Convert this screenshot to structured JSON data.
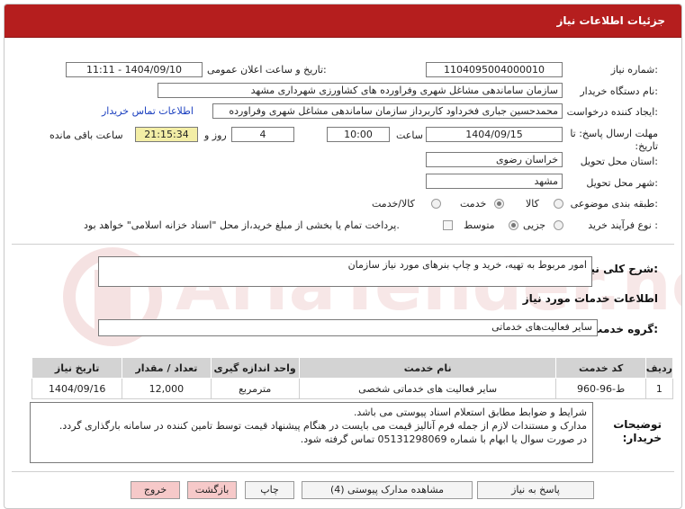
{
  "header": {
    "title": "جزئیات اطلاعات نیاز"
  },
  "form": {
    "need_number_label": "شماره نیاز:",
    "need_number": "1104095004000010",
    "announce_label": "تاریخ و ساعت اعلان عمومی:",
    "announce_value": "1404/09/10 - 11:11",
    "buyer_org_label": "نام دستگاه خریدار:",
    "buyer_org": "سازمان ساماندهی مشاغل شهری وفراورده های کشاورزی شهرداری مشهد",
    "creator_label": "ایجاد کننده درخواست:",
    "creator": "محمدحسین جباری فخرداود کاربرداز سازمان ساماندهی مشاغل شهری وفراورده",
    "contact_link": "اطلاعات تماس خریدار",
    "deadline_label": "مهلت ارسال پاسخ: تا تاریخ:",
    "deadline_date": "1404/09/15",
    "time_label": "ساعت",
    "deadline_time": "10:00",
    "days_value": "4",
    "days_label": "روز و",
    "remaining_time": "21:15:34",
    "remaining_label": "ساعت باقی مانده",
    "province_label": "استان محل تحویل:",
    "province": "خراسان رضوی",
    "city_label": "شهر محل تحویل:",
    "city": "مشهد",
    "category_label": "طبقه بندی موضوعی:",
    "category_options": [
      "کالا",
      "خدمت",
      "کالا/خدمت"
    ],
    "category_selected": "خدمت",
    "process_label": "نوع فرآیند خرید :",
    "process_options": [
      "جزیی",
      "متوسط"
    ],
    "process_selected": "متوسط",
    "payment_note": "پرداخت تمام یا بخشی از مبلغ خرید،از محل \"اسناد خزانه اسلامی\" خواهد بود."
  },
  "description": {
    "label": "شرح کلی نیاز:",
    "value": "امور مربوط به تهیه، خرید و چاپ بنرهای مورد نیاز سازمان"
  },
  "services": {
    "heading": "اطلاعات خدمات مورد نیاز",
    "group_label": "گروه خدمت:",
    "group_value": "سایر فعالیت‌های خدماتی",
    "columns": [
      "ردیف",
      "کد خدمت",
      "نام خدمت",
      "واحد اندازه گیری",
      "تعداد / مقدار",
      "تاریخ نیاز"
    ],
    "rows": [
      [
        "1",
        "ط-96-960",
        "سایر فعالیت های خدماتی شخصی",
        "مترمربع",
        "12,000",
        "1404/09/16"
      ]
    ]
  },
  "notes": {
    "label": "توضیحات خریدار:",
    "lines": [
      "شرایط و ضوابط مطابق استعلام اسناد پیوستی می باشد.",
      "مدارک و مستندات لازم از جمله فرم آنالیز قیمت می بایست در هنگام پیشنهاد قیمت توسط تامین کننده در سامانه بارگذاری گردد.",
      "در صورت سوال یا ابهام با شماره 05131298069 تماس گرفته شود."
    ]
  },
  "buttons": {
    "reply": "پاسخ به نیاز",
    "attachments": "مشاهده مدارک پیوستی (4)",
    "print": "چاپ",
    "back": "بازگشت",
    "exit": "خروج"
  },
  "watermark": {
    "text": "AriaTender.net",
    "color": "#b51e1e"
  }
}
